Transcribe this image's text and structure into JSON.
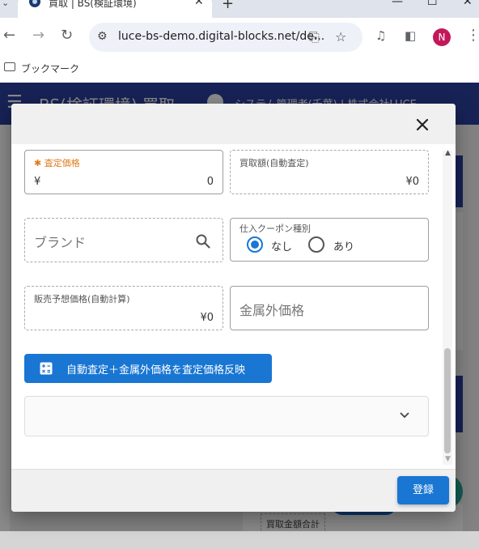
{
  "browser": {
    "tab_title": "買取 | BS(検証環境)",
    "url": "luce-bs-demo.digital-blocks.net/de...",
    "profile_initial": "N",
    "bookmarks_label": "ブックマーク",
    "icons": [
      "back-icon",
      "forward-icon",
      "reload-icon",
      "site-info-icon",
      "install-icon",
      "star-icon",
      "media-icon",
      "sidepanel-icon",
      "more-icon"
    ]
  },
  "app": {
    "title": "BS(検証環境) 買取",
    "user_label": "システム管理者(千葉) | 株式会社LUCE",
    "bottom_label": "買取金額合計",
    "colors": {
      "appbar": "#2b3fa0",
      "accent": "#1976d2",
      "required": "#e07b1a"
    }
  },
  "dialog": {
    "fields": {
      "assessed_price": {
        "label": "査定価格",
        "required_mark": "✱",
        "prefix": "¥",
        "value": "0"
      },
      "auto_purchase": {
        "label": "買取額(自動査定)",
        "value": "¥0"
      },
      "brand": {
        "placeholder": "ブランド"
      },
      "coupon": {
        "label": "仕入クーポン種別",
        "options": [
          "なし",
          "あり"
        ],
        "selected": "なし"
      },
      "predicted_sale": {
        "label": "販売予想価格(自動計算)",
        "value": "¥0"
      },
      "non_metal_price": {
        "placeholder": "金属外価格"
      }
    },
    "reflect_button": "自動査定＋金属外価格を査定価格反映",
    "register_button": "登録"
  }
}
